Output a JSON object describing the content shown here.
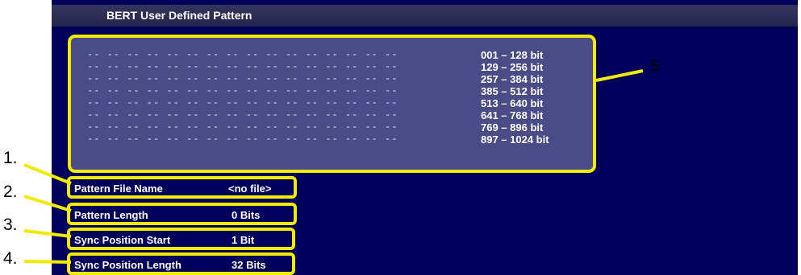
{
  "window": {
    "title": "BERT User Defined Pattern"
  },
  "pattern": {
    "rows": [
      "-- -- -- -- -- -- -- -- -- -- -- -- -- -- -- --",
      "-- -- -- -- -- -- -- -- -- -- -- -- -- -- -- --",
      "-- -- -- -- -- -- -- -- -- -- -- -- -- -- -- --",
      "-- -- -- -- -- -- -- -- -- -- -- -- -- -- -- --",
      "-- -- -- -- -- -- -- -- -- -- -- -- -- -- -- --",
      "-- -- -- -- -- -- -- -- -- -- -- -- -- -- -- --",
      "-- -- -- -- -- -- -- -- -- -- -- -- -- -- -- --",
      "-- -- -- -- -- -- -- -- -- -- -- -- -- -- -- --"
    ],
    "ranges": [
      "001 – 128 bit",
      "129 – 256 bit",
      "257 – 384 bit",
      "385 – 512 bit",
      "513 – 640 bit",
      "641 – 768 bit",
      "769 – 896 bit",
      "897 – 1024 bit"
    ]
  },
  "fields": {
    "file_name": {
      "label": "Pattern File Name",
      "value": "<no file>"
    },
    "length": {
      "label": "Pattern Length",
      "value": "0 Bits"
    },
    "sync_start": {
      "label": "Sync Position Start",
      "value": "1 Bit"
    },
    "sync_length": {
      "label": "Sync Position Length",
      "value": "32 Bits"
    }
  },
  "annotations": {
    "m1": "1.",
    "m2": "2.",
    "m3": "3.",
    "m4": "4.",
    "m5": "5"
  },
  "colors": {
    "highlight": "#f2ea00",
    "screen": "#00005c",
    "panel": "#4a4c88"
  }
}
